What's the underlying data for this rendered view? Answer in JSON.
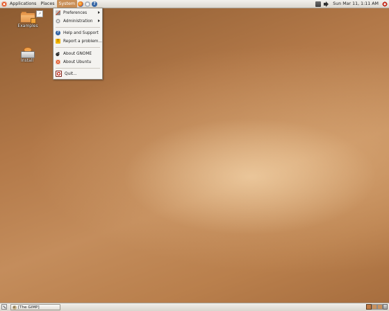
{
  "top_panel": {
    "menus": [
      "Applications",
      "Places",
      "System"
    ],
    "active_menu": "System",
    "clock": "Sun Mar 11,  1:11 AM"
  },
  "desktop": {
    "icons": [
      {
        "label": "Examples",
        "icon": "folder-icon"
      },
      {
        "label": "Install",
        "icon": "drive-icon"
      }
    ]
  },
  "system_menu": {
    "items": [
      {
        "label": "Preferences",
        "icon": "preferences-icon",
        "submenu": true
      },
      {
        "label": "Administration",
        "icon": "administration-icon",
        "submenu": true
      },
      {
        "label": "Help and Support",
        "icon": "help-icon"
      },
      {
        "label": "Report a problem...",
        "icon": "bug-icon"
      },
      {
        "label": "About GNOME",
        "icon": "gnome-icon"
      },
      {
        "label": "About Ubuntu",
        "icon": "ubuntu-icon"
      },
      {
        "label": "Quit...",
        "icon": "quit-icon"
      }
    ]
  },
  "bottom_panel": {
    "tasks": [
      {
        "label": "[The GIMP]",
        "icon": "gimp-icon"
      }
    ],
    "workspaces": 4,
    "active_workspace": 1
  },
  "colors": {
    "desktop_accent": "#c48d5c",
    "menu_highlight": "#c98f57",
    "ubuntu_orange": "#dd4814"
  }
}
